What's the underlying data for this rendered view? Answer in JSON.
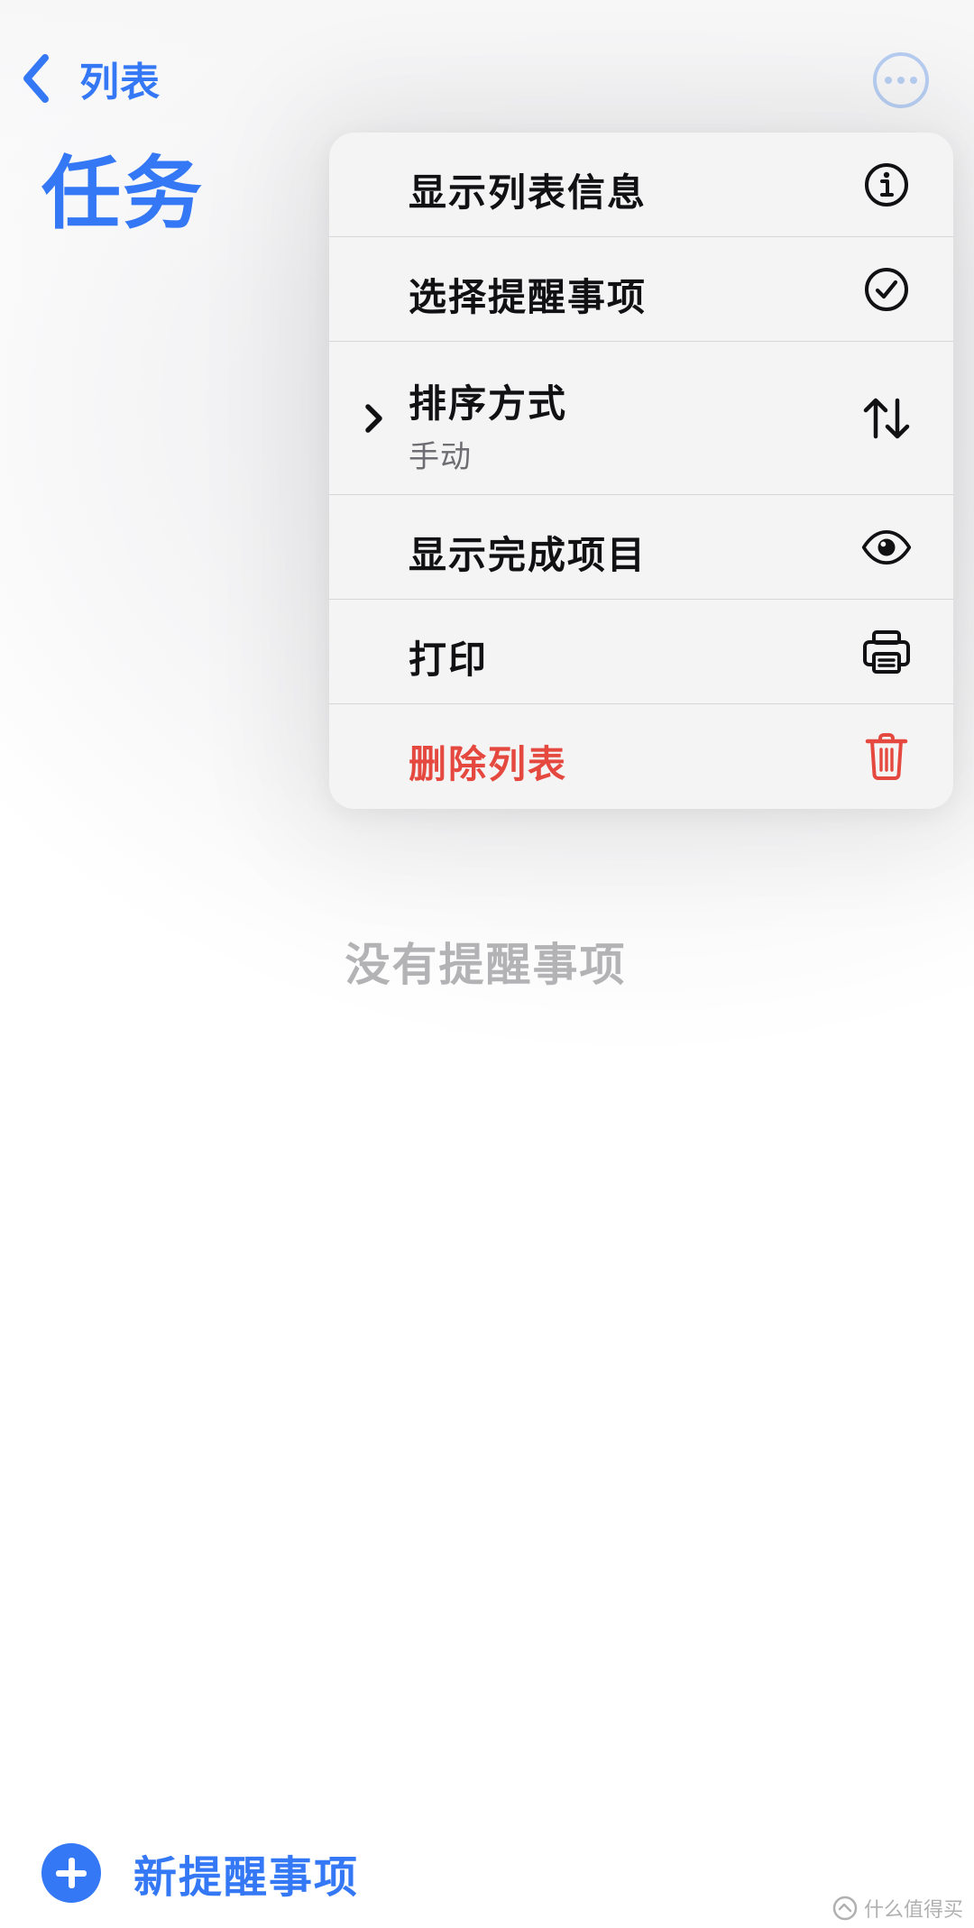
{
  "nav": {
    "back_label": "列表",
    "back_icon": "chevron-left-icon",
    "more_icon": "ellipsis-circle-icon"
  },
  "page": {
    "title": "任务",
    "empty_text": "没有提醒事项"
  },
  "menu": {
    "items": [
      {
        "label": "显示列表信息",
        "icon": "info-circle-icon"
      },
      {
        "label": "选择提醒事项",
        "icon": "checkmark-circle-icon"
      },
      {
        "label": "排序方式",
        "sublabel": "手动",
        "icon": "arrow-up-down-icon",
        "has_submenu": true
      },
      {
        "label": "显示完成项目",
        "icon": "eye-icon"
      },
      {
        "label": "打印",
        "icon": "printer-icon"
      },
      {
        "label": "删除列表",
        "icon": "trash-icon",
        "destructive": true
      }
    ]
  },
  "bottom": {
    "new_reminder_label": "新提醒事项"
  },
  "watermark": {
    "text": "什么值得买"
  },
  "colors": {
    "accent": "#3478f6",
    "destructive": "#e5483f",
    "menu_bg": "#f4f4f5",
    "secondary_text": "#6d6d72",
    "placeholder_text": "#b3b3b6"
  }
}
